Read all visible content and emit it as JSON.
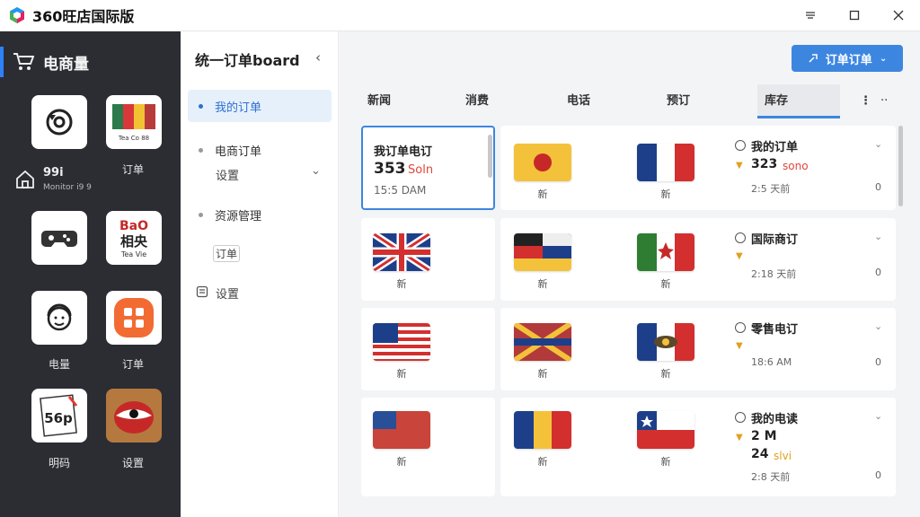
{
  "window": {
    "title": "360旺店国际版",
    "minimize": "—",
    "maximize": "☐",
    "close": "✕"
  },
  "sidebar": {
    "title": "电商量",
    "home_label": "99i",
    "home_sub": "Monitor i9 9",
    "apps": [
      {
        "id": "a1",
        "label": "",
        "icon": "at-refresh-icon"
      },
      {
        "id": "a2",
        "label": "订单",
        "icon": "colorful-grid-icon",
        "tile_text": "Tea Co 88"
      },
      {
        "id": "a3",
        "label": "",
        "icon": "gamepad-icon"
      },
      {
        "id": "a4",
        "label": "",
        "icon": "text-logo-icon",
        "tile_text": "BaO",
        "tile_text2": "相央",
        "tile_text3": "Tea Vie"
      },
      {
        "id": "a5",
        "label": "电量",
        "icon": "headset-face-icon"
      },
      {
        "id": "a6",
        "label": "订单",
        "icon": "orange-grid-icon"
      },
      {
        "id": "a7",
        "label": "明码",
        "icon": "56px-icon",
        "tile_text": "56p"
      },
      {
        "id": "a8",
        "label": "设置",
        "icon": "dish-icon"
      }
    ]
  },
  "nav": {
    "title": "统一订单board",
    "collapse": "‹",
    "items": [
      {
        "label": "我的订单",
        "active": true
      },
      {
        "label": "电商订单",
        "active": false
      },
      {
        "label": "资源管理",
        "active": false
      }
    ],
    "sub_label": "设置",
    "sub_label2": "订单",
    "footer_label": "设置"
  },
  "toolbar": {
    "button_label": "订单订单"
  },
  "tabs": [
    {
      "label": "新闻",
      "active": false
    },
    {
      "label": "消费",
      "active": false
    },
    {
      "label": "电话",
      "active": false
    },
    {
      "label": "预订",
      "active": false
    },
    {
      "label": "库存",
      "active": true
    }
  ],
  "order_card": {
    "title": "我订单电订",
    "number": "353",
    "sub": "Soln",
    "time": "15:5 DAM"
  },
  "rows": [
    {
      "flags": [
        {
          "label": "新",
          "flag": "red-circle"
        },
        {
          "label": "新",
          "flag": "france"
        }
      ],
      "title": "我的订单",
      "value": "323",
      "value_red": "sono",
      "time": "2:5 天前",
      "count": "0"
    },
    {
      "flags": [
        {
          "label": "新",
          "flag": "uk"
        },
        {
          "label": "新",
          "flag": "germany-russia"
        },
        {
          "label": "新",
          "flag": "italy-canada"
        }
      ],
      "title": "国际商订",
      "value": "",
      "value_red": "",
      "time": "2:18 天前",
      "count": "0"
    },
    {
      "flags": [
        {
          "label": "新",
          "flag": "usa"
        },
        {
          "label": "新",
          "flag": "uk-red"
        },
        {
          "label": "新",
          "flag": "france-eye"
        }
      ],
      "title": "零售电订",
      "value": "",
      "value_red": "",
      "time": "18:6 AM",
      "count": "0"
    },
    {
      "flags": [
        {
          "label": "新",
          "flag": "red-us"
        },
        {
          "label": "新",
          "flag": "romania"
        },
        {
          "label": "新",
          "flag": "chile"
        }
      ],
      "title": "我的电读",
      "value": "2 M",
      "value2": "24",
      "value_red": "slvi",
      "time": "2:8 天前",
      "count": "0"
    }
  ],
  "colors": {
    "accent": "#3d86e0",
    "sidebar_bg": "#2b2d33",
    "red": "#e0453a",
    "amber": "#e0a020"
  }
}
